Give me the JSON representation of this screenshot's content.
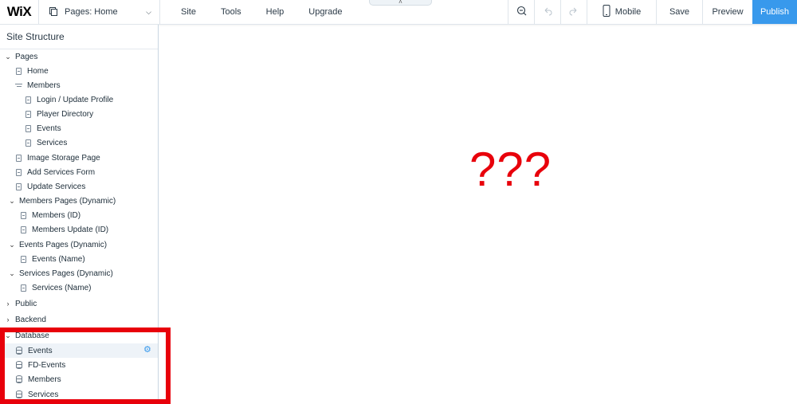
{
  "topbar": {
    "logo": "WiX",
    "pages_dropdown": "Pages: Home",
    "menu": [
      "Site",
      "Tools",
      "Help",
      "Upgrade"
    ],
    "mobile_label": "Mobile",
    "save_label": "Save",
    "preview_label": "Preview",
    "publish_label": "Publish",
    "collapse_glyph": "˄"
  },
  "sidebar": {
    "title": "Site Structure",
    "tree": {
      "pages": "Pages",
      "home": "Home",
      "members": "Members",
      "login": "Login / Update Profile",
      "player_directory": "Player Directory",
      "events": "Events",
      "services": "Services",
      "image_storage": "Image Storage Page",
      "add_services_form": "Add Services Form",
      "update_services": "Update Services",
      "members_pages_dynamic": "Members Pages (Dynamic)",
      "members_id": "Members (ID)",
      "members_update_id": "Members Update (ID)",
      "events_pages_dynamic": "Events Pages (Dynamic)",
      "events_name": "Events (Name)",
      "services_pages_dynamic": "Services Pages (Dynamic)",
      "services_name": "Services (Name)",
      "public": "Public",
      "backend": "Backend",
      "database": "Database",
      "db_events": "Events",
      "db_fd_events": "FD-Events",
      "db_members": "Members",
      "db_services": "Services"
    }
  },
  "canvas": {
    "annotation": "???"
  },
  "colors": {
    "publish": "#3899ec",
    "highlight": "#e8000b",
    "gear": "#3899ec"
  }
}
